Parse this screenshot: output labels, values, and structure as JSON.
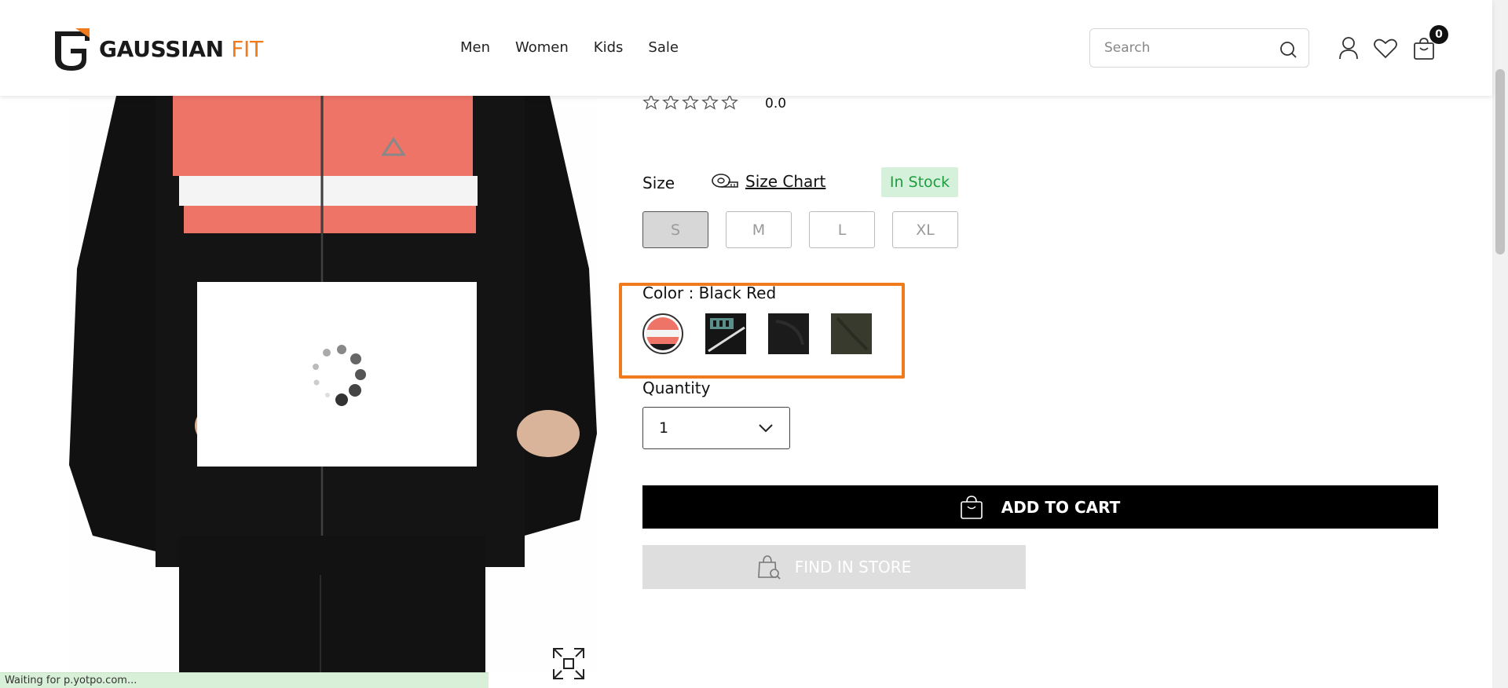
{
  "header": {
    "logo": {
      "brand": "GAUSSIAN",
      "accent": "FIT"
    },
    "nav": [
      "Men",
      "Women",
      "Kids",
      "Sale"
    ],
    "search": {
      "placeholder": "Search",
      "value": ""
    },
    "cart_count": "0"
  },
  "product": {
    "rating_value": "0.0",
    "rating_stars": 0,
    "size": {
      "label": "Size",
      "chart_label": "Size Chart",
      "stock": "In Stock",
      "options": [
        "S",
        "M",
        "L",
        "XL"
      ],
      "selected": "S"
    },
    "color": {
      "label": "Color : Black Red",
      "swatch_count": 4,
      "selected_index": 0
    },
    "quantity": {
      "label": "Quantity",
      "value": "1"
    },
    "add_to_cart": "ADD TO CART",
    "find_in_store": "FIND IN STORE"
  },
  "status_bar": "Waiting for p.yotpo.com...",
  "colors": {
    "accent_orange": "#f07b1d",
    "stock_green": "#1e9d3e",
    "stock_bg": "#d6f1db",
    "jacket_red": "#ee7468",
    "button_black": "#000000"
  }
}
